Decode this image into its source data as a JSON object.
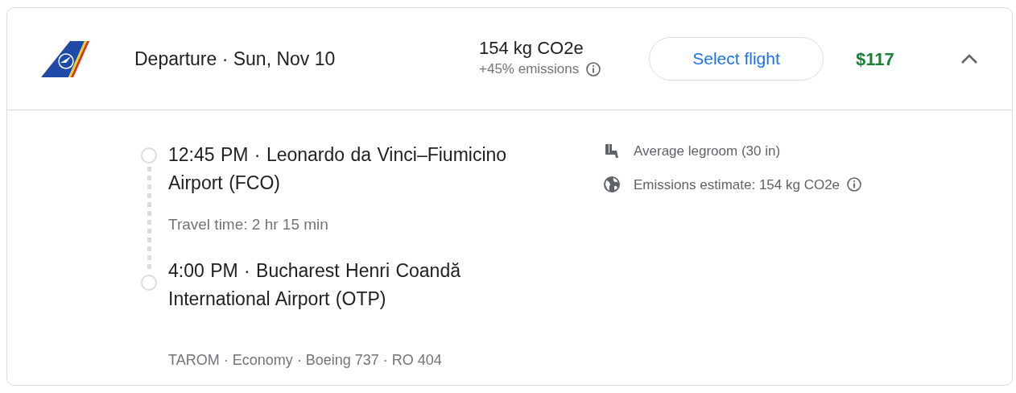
{
  "header": {
    "title": "Departure · Sun, Nov 10",
    "emissions": "154 kg CO2e",
    "emissions_note": "+45% emissions",
    "button": "Select flight",
    "price": "$117",
    "expanded": true
  },
  "stops": [
    {
      "text": "12:45 PM · Leonardo da Vinci–Fiumicino Airport (FCO)"
    },
    {
      "text": "4:00 PM · Bucharest Henri Coandă International Airport (OTP)"
    }
  ],
  "travel_time": "Travel time: 2 hr 15 min",
  "amenities": [
    {
      "kind": "legroom",
      "text": "Average legroom (30 in)",
      "info": false
    },
    {
      "kind": "emissions",
      "text": "Emissions estimate: 154 kg CO2e",
      "info": true
    }
  ],
  "flight_info": "TAROM · Economy · Boeing 737 · RO 404"
}
